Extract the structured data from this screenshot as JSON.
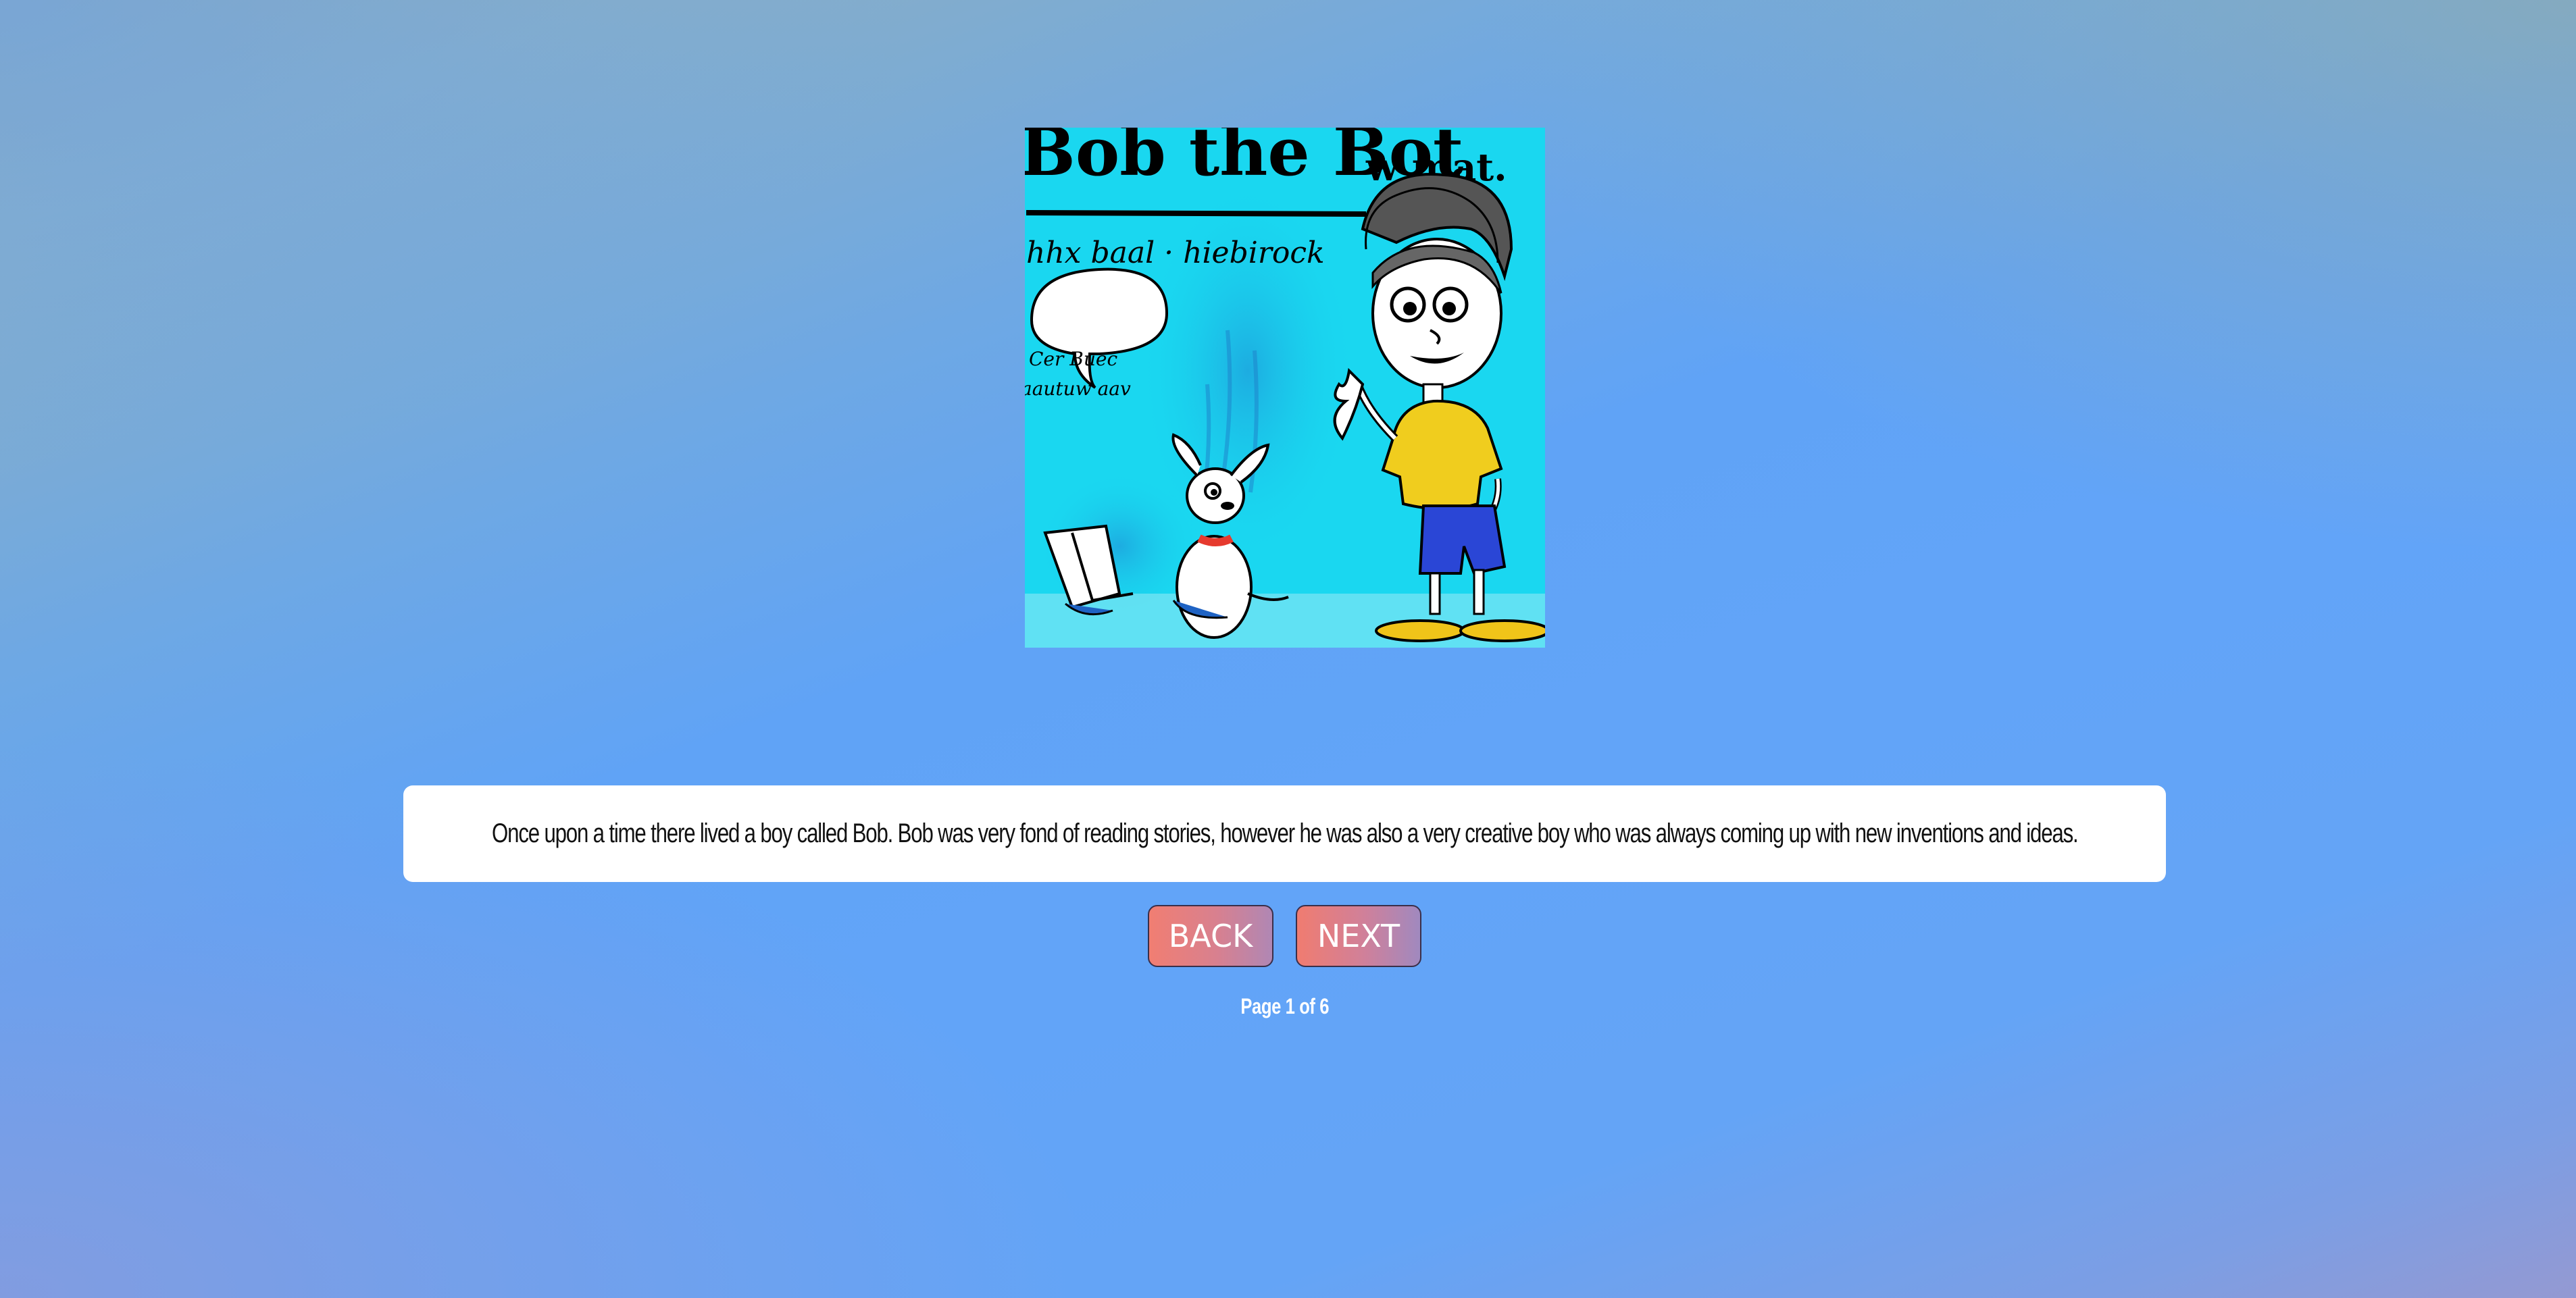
{
  "story": {
    "illustration": {
      "alt_title": "Bob the Bot",
      "caption_art": [
        "Bob the Bot",
        "w mat.",
        "hhx baal · hiebirock",
        "Cer Buec",
        "aautuw aav"
      ]
    },
    "text": "Once upon a time there lived a boy called Bob. Bob was very fond of reading stories, however he was also a very creative boy who was always coming up with new inventions and ideas."
  },
  "navigation": {
    "back_label": "BACK",
    "next_label": "NEXT"
  },
  "pagination": {
    "label": "Page 1 of 6",
    "current": 1,
    "total": 6
  },
  "colors": {
    "background_main": "#62a4f8",
    "button_start": "#f17e72",
    "button_end": "#b087b4",
    "illustration_bg": "#1ad7f0",
    "card": "#ffffff"
  }
}
